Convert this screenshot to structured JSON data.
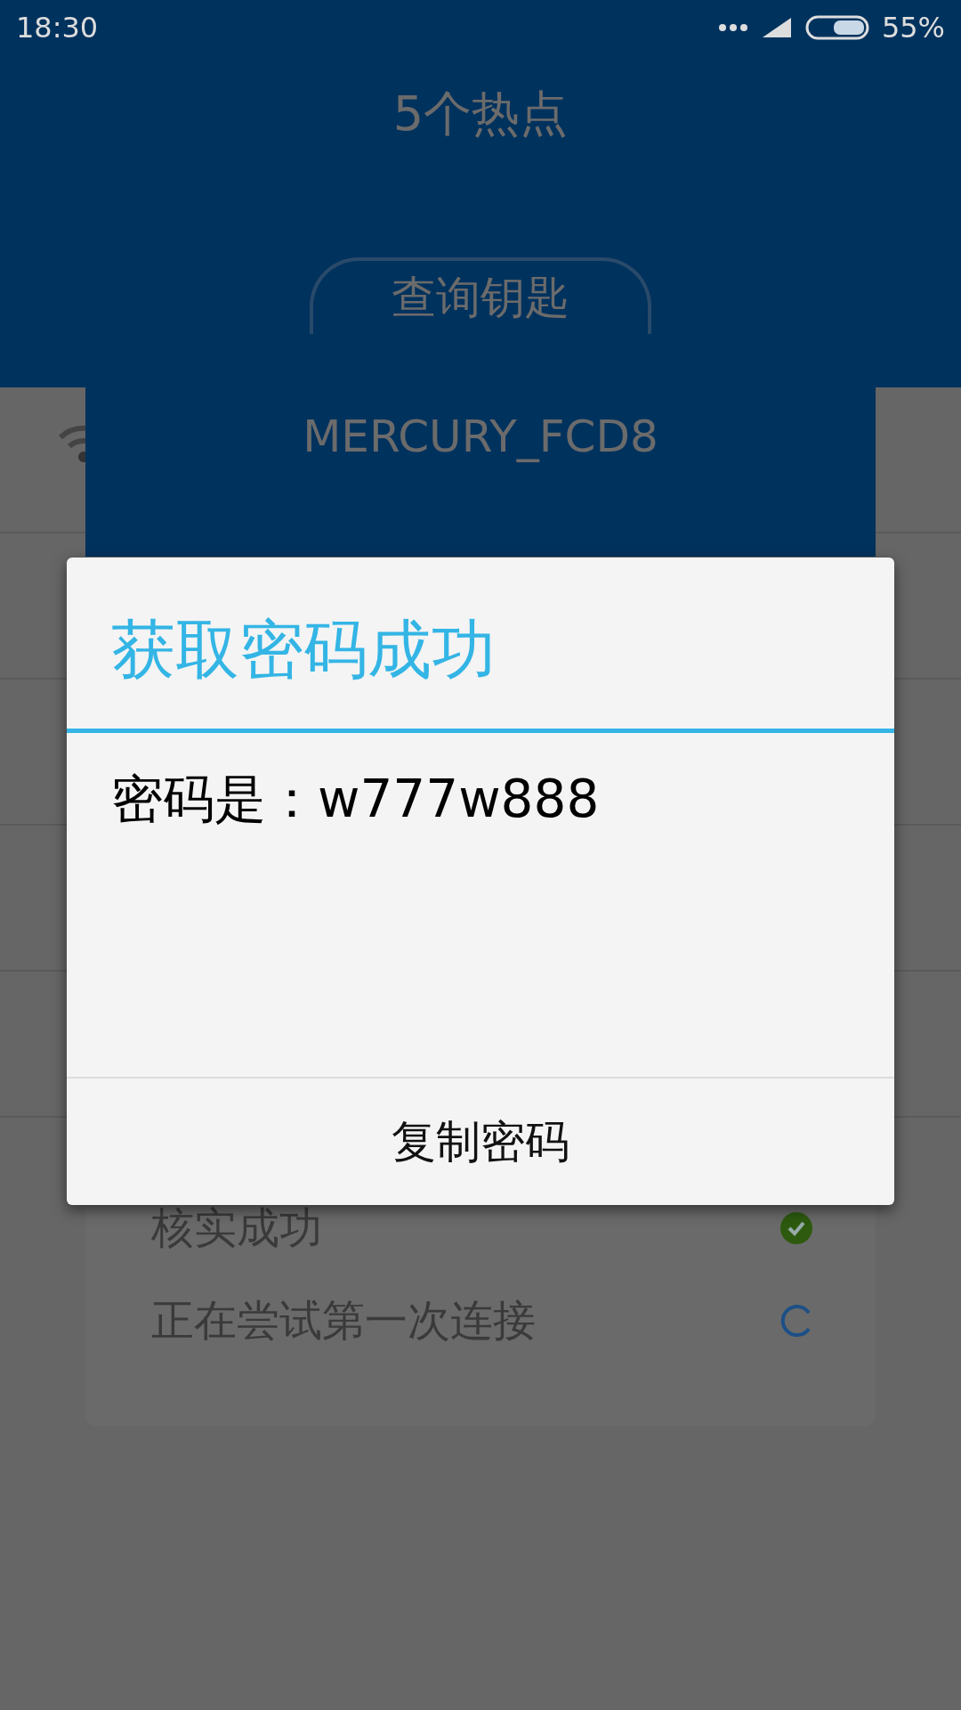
{
  "status_bar": {
    "time": "18:30",
    "battery": "55%"
  },
  "header": {
    "title": "5个热点",
    "button": "查询钥匙"
  },
  "hotspot_card": {
    "ssid": "MERCURY_FCD8",
    "steps": [
      {
        "label": "核实成功",
        "kind": "done"
      },
      {
        "label": "正在尝试第一次连接",
        "kind": "loading"
      }
    ]
  },
  "dialog": {
    "title": "获取密码成功",
    "message": "密码是：w777w888",
    "button": "复制密码"
  }
}
